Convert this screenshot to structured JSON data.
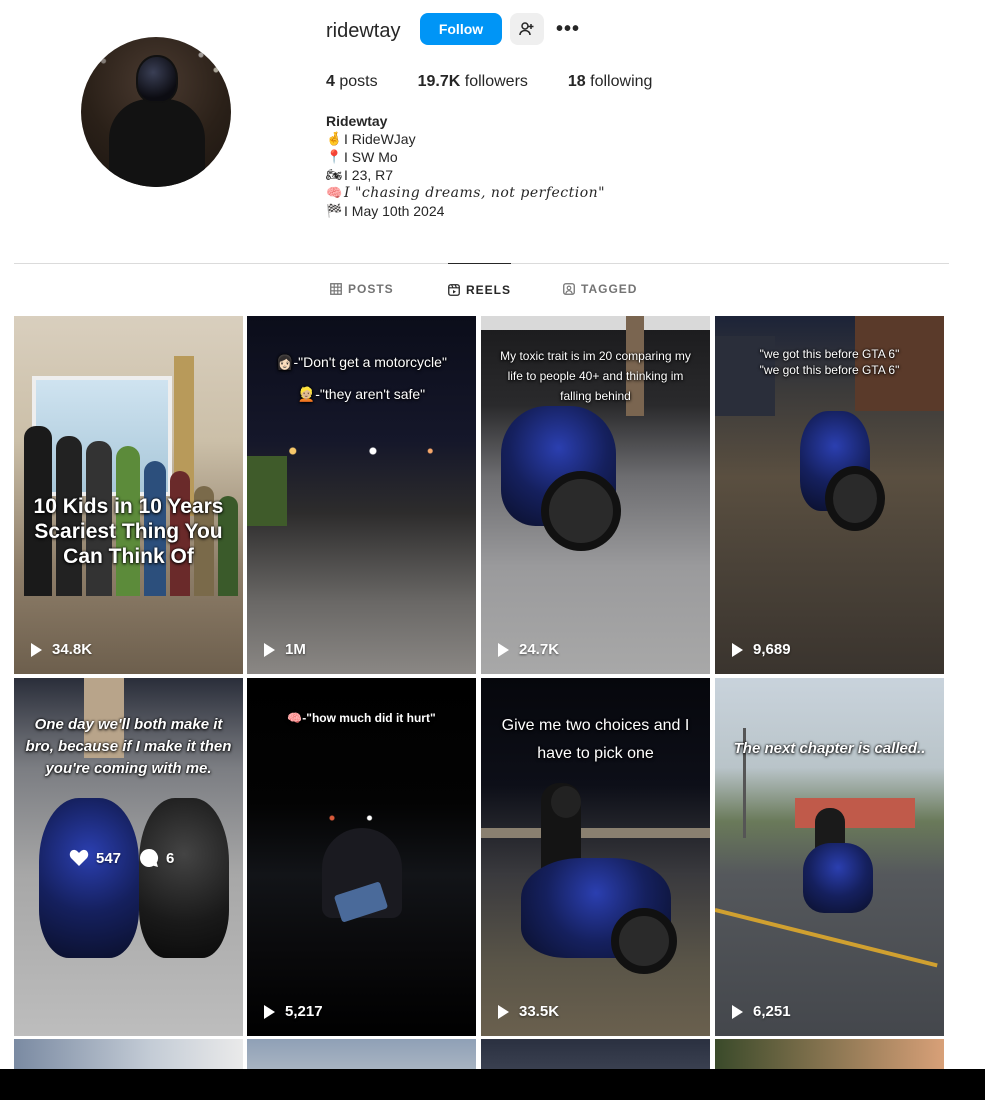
{
  "profile": {
    "username": "ridewtay",
    "follow_label": "Follow",
    "more_label": "•••",
    "stats": {
      "posts_count": "4",
      "posts_label": "posts",
      "followers_count": "19.7K",
      "followers_label": "followers",
      "following_count": "18",
      "following_label": "following"
    },
    "bio": {
      "name": "Ridewtay",
      "lines": [
        {
          "emoji": "🤞",
          "text": "I RideWJay"
        },
        {
          "emoji": "📍",
          "text": "I SW Mo"
        },
        {
          "emoji": "🏍",
          "text": "I 23, R7"
        },
        {
          "emoji": "🧠",
          "text": "I \"chasing dreams, not perfection\""
        },
        {
          "emoji": "🏁",
          "text": "I May 10th 2024"
        }
      ]
    }
  },
  "tabs": [
    {
      "label": "POSTS",
      "icon": "grid-icon",
      "active": false
    },
    {
      "label": "REELS",
      "icon": "reels-icon",
      "active": true
    },
    {
      "label": "TAGGED",
      "icon": "tagged-icon",
      "active": false
    }
  ],
  "reels": [
    {
      "caption": "10 Kids in 10 Years Scariest Thing You Can Think Of",
      "views": "34.8K"
    },
    {
      "caption": "👩🏻-\"Don't get a motorcycle\"\n👱🏼-\"they aren't safe\"",
      "views": "1M"
    },
    {
      "caption": "My toxic trait is im 20 comparing my life to people 40+ and thinking im falling behind",
      "views": "24.7K"
    },
    {
      "caption": "\"we got this before GTA 6\"\n\"we got this before GTA 6\"",
      "views": "9,689"
    },
    {
      "caption": "One day we'll both make it bro, because if I make it then you're coming with me.",
      "likes": "547",
      "comments": "6"
    },
    {
      "caption": "🧠-\"how much did it hurt\"",
      "views": "5,217"
    },
    {
      "caption": "Give me two choices and I have to pick one",
      "views": "33.5K"
    },
    {
      "caption": "The next chapter is called..",
      "views": "6,251"
    }
  ],
  "colors": {
    "accent": "#0095f6",
    "text": "#262626",
    "muted": "#737373",
    "divider": "#dbdbdb"
  }
}
